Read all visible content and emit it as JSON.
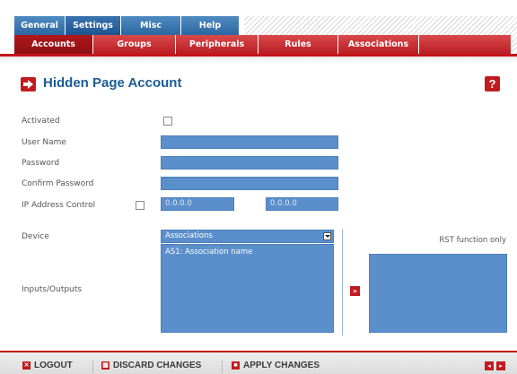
{
  "tabs_primary": [
    {
      "label": "General",
      "active": false
    },
    {
      "label": "Settings",
      "active": true
    },
    {
      "label": "Misc",
      "active": false
    },
    {
      "label": "Help",
      "active": false
    }
  ],
  "tabs_secondary": [
    {
      "label": "Accounts",
      "active": true
    },
    {
      "label": "Groups",
      "active": false
    },
    {
      "label": "Peripherals",
      "active": false
    },
    {
      "label": "Rules",
      "active": false
    },
    {
      "label": "Associations",
      "active": false
    }
  ],
  "page": {
    "title": "Hidden Page Account",
    "help_icon": "?"
  },
  "form": {
    "activated_label": "Activated",
    "user_name_label": "User Name",
    "password_label": "Password",
    "confirm_password_label": "Confirm Password",
    "ip_control_label": "IP Address Control",
    "ip_from": "0.0.0.0",
    "ip_to": "0.0.0.0",
    "device_label": "Device",
    "device_selected": "Associations",
    "io_label": "Inputs/Outputs",
    "io_items": [
      "AS1: Association name"
    ],
    "move_icon": "»",
    "rst_label": "RST function only"
  },
  "footer": {
    "logout": "LOGOUT",
    "discard": "DISCARD CHANGES",
    "apply": "APPLY CHANGES"
  },
  "colors": {
    "tab_blue": "#2c67a1",
    "tab_red": "#b81d22",
    "field_blue": "#5b8fcb",
    "title_blue": "#1a5c96",
    "accent_red": "#c11b1f"
  }
}
